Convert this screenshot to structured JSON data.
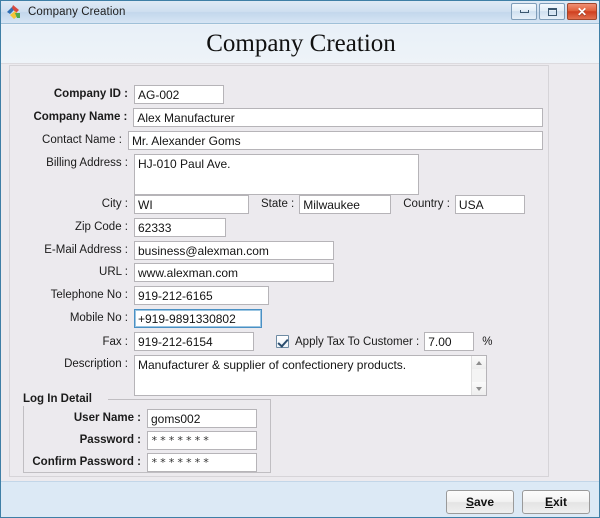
{
  "window": {
    "title": "Company Creation",
    "icon": "app-logo-icon",
    "controls": {
      "minimize": "minimize-icon",
      "maximize": "maximize-icon",
      "close": "✕"
    }
  },
  "heading": "Company Creation",
  "form": {
    "company_id": {
      "label": "Company ID :",
      "value": "AG-002",
      "bold": true
    },
    "company_name": {
      "label": "Company Name :",
      "value": "Alex Manufacturer",
      "bold": true
    },
    "contact_name": {
      "label": "Contact Name :",
      "value": "Mr. Alexander Goms"
    },
    "billing_address": {
      "label": "Billing Address :",
      "value": "HJ-010 Paul Ave."
    },
    "city": {
      "label": "City :",
      "value": "WI"
    },
    "state": {
      "label": "State :",
      "value": "Milwaukee"
    },
    "country": {
      "label": "Country :",
      "value": "USA"
    },
    "zip_code": {
      "label": "Zip Code :",
      "value": "62333"
    },
    "email": {
      "label": "E-Mail Address :",
      "value": "business@alexman.com"
    },
    "url": {
      "label": "URL :",
      "value": "www.alexman.com"
    },
    "telephone": {
      "label": "Telephone No :",
      "value": "919-212-6165"
    },
    "mobile": {
      "label": "Mobile No :",
      "value": "+919-9891330802"
    },
    "fax": {
      "label": "Fax :",
      "value": "919-212-6154"
    },
    "apply_tax": {
      "label": "Apply Tax To Customer :",
      "checked": true,
      "value": "7.00",
      "unit": "%"
    },
    "description": {
      "label": "Description :",
      "value": "Manufacturer & supplier of confectionery products."
    }
  },
  "login_detail": {
    "group_title": "Log In Detail",
    "user_name": {
      "label": "User Name :",
      "value": "goms002"
    },
    "password": {
      "label": "Password :",
      "value": "*******"
    },
    "confirm_password": {
      "label": "Confirm Password :",
      "value": "*******"
    }
  },
  "footer": {
    "save": {
      "prefix": "",
      "accel": "S",
      "suffix": "ave"
    },
    "exit": {
      "prefix": "",
      "accel": "E",
      "suffix": "xit"
    }
  }
}
